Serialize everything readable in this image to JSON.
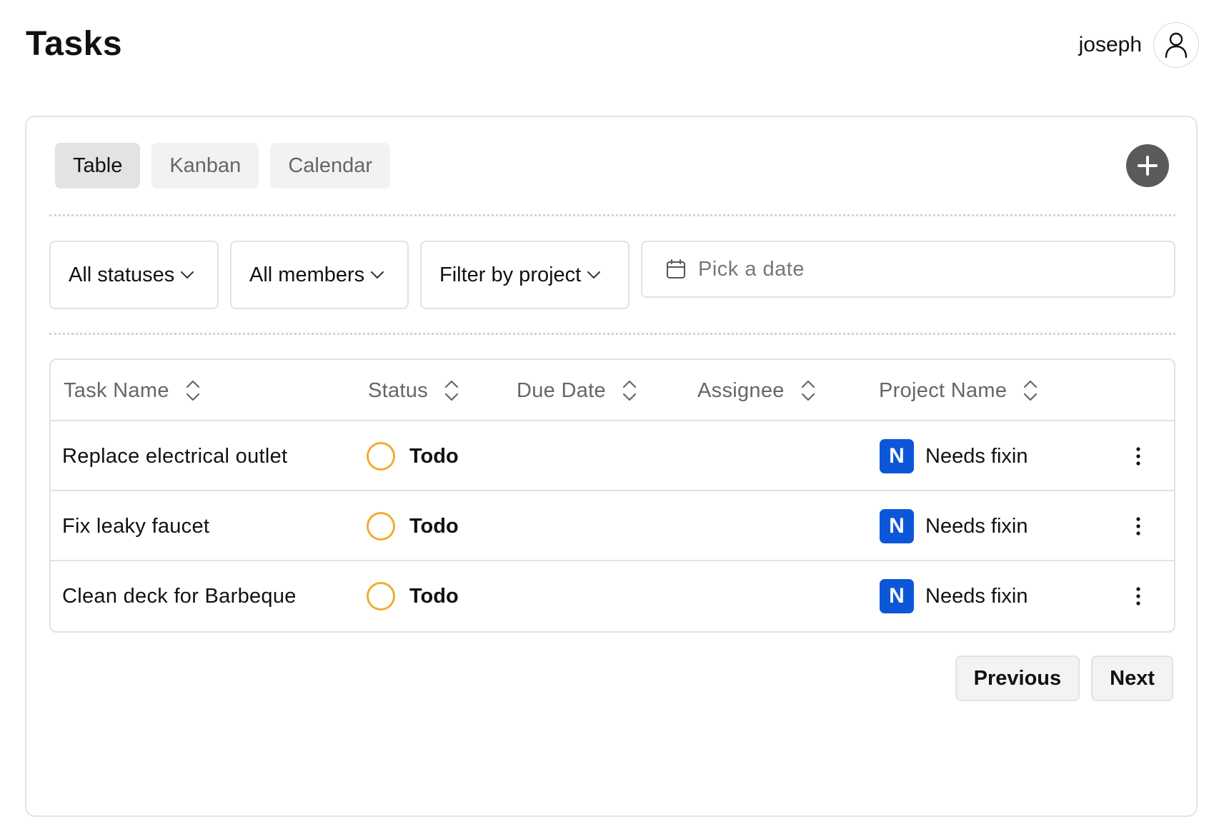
{
  "header": {
    "title": "Tasks",
    "username": "joseph",
    "avatar_icon": "user-icon"
  },
  "views": {
    "tabs": [
      {
        "label": "Table",
        "active": true
      },
      {
        "label": "Kanban",
        "active": false
      },
      {
        "label": "Calendar",
        "active": false
      }
    ],
    "add_icon": "plus-icon"
  },
  "filters": {
    "status": "All statuses",
    "members": "All members",
    "project": "Filter by project",
    "date_placeholder": "Pick a date"
  },
  "table": {
    "columns": [
      "Task Name",
      "Status",
      "Due Date",
      "Assignee",
      "Project Name"
    ],
    "rows": [
      {
        "task": "Replace electrical outlet",
        "status": "Todo",
        "due_date": "",
        "assignee": "",
        "project_initial": "N",
        "project": "Needs fixin"
      },
      {
        "task": "Fix leaky faucet",
        "status": "Todo",
        "due_date": "",
        "assignee": "",
        "project_initial": "N",
        "project": "Needs fixin"
      },
      {
        "task": "Clean deck for Barbeque",
        "status": "Todo",
        "due_date": "",
        "assignee": "",
        "project_initial": "N",
        "project": "Needs fixin"
      }
    ]
  },
  "pagination": {
    "previous": "Previous",
    "next": "Next"
  },
  "colors": {
    "status_todo": "#f0ad32",
    "project_badge": "#0b57d8",
    "add_button": "#5a5a5a"
  }
}
